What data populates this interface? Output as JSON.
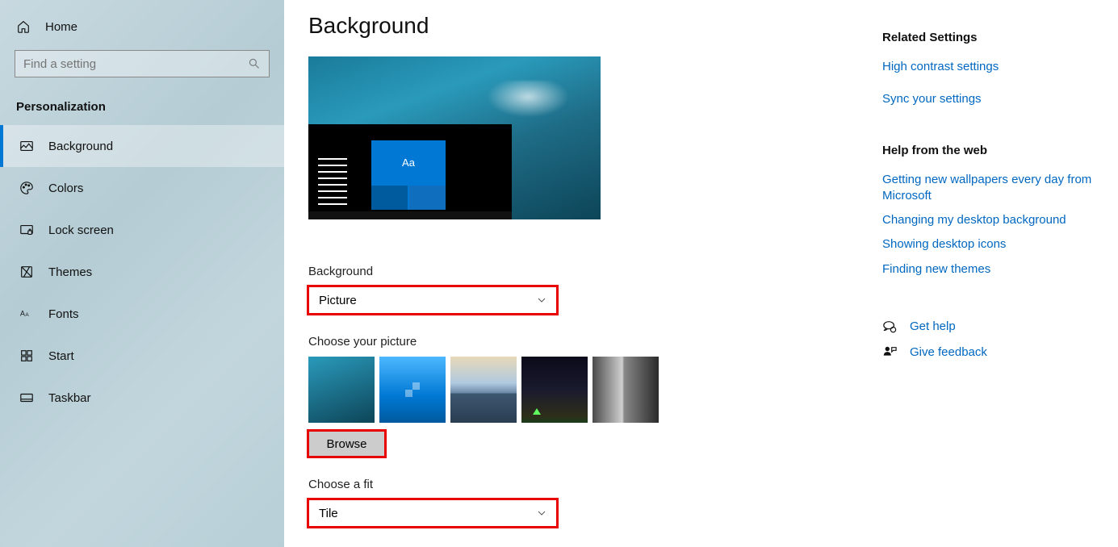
{
  "sidebar": {
    "home": "Home",
    "searchPlaceholder": "Find a setting",
    "section": "Personalization",
    "items": [
      {
        "label": "Background",
        "icon": "picture-icon",
        "active": true
      },
      {
        "label": "Colors",
        "icon": "palette-icon",
        "active": false
      },
      {
        "label": "Lock screen",
        "icon": "lockscreen-icon",
        "active": false
      },
      {
        "label": "Themes",
        "icon": "themes-icon",
        "active": false
      },
      {
        "label": "Fonts",
        "icon": "fonts-icon",
        "active": false
      },
      {
        "label": "Start",
        "icon": "start-icon",
        "active": false
      },
      {
        "label": "Taskbar",
        "icon": "taskbar-icon",
        "active": false
      }
    ]
  },
  "main": {
    "title": "Background",
    "previewTileText": "Aa",
    "backgroundLabel": "Background",
    "backgroundValue": "Picture",
    "choosePictureLabel": "Choose your picture",
    "browseLabel": "Browse",
    "chooseFitLabel": "Choose a fit",
    "chooseFitValue": "Tile"
  },
  "right": {
    "relatedTitle": "Related Settings",
    "relatedLinks": [
      "High contrast settings",
      "Sync your settings"
    ],
    "helpTitle": "Help from the web",
    "helpLinks": [
      "Getting new wallpapers every day from Microsoft",
      "Changing my desktop background",
      "Showing desktop icons",
      "Finding new themes"
    ],
    "getHelp": "Get help",
    "giveFeedback": "Give feedback"
  }
}
